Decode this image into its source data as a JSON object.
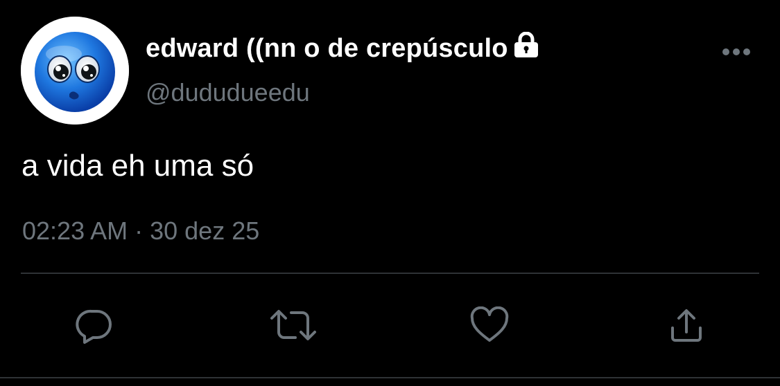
{
  "tweet": {
    "display_name": "edward ((nn o de crepúsculo",
    "handle": "@dududueedu",
    "text": "a vida eh uma só",
    "time": "02:23 AM",
    "separator": "·",
    "date": "30 dez 25"
  },
  "icons": {
    "lock": "lock-icon",
    "more": "more-horizontal-icon",
    "reply": "reply-bubble-icon",
    "retweet": "retweet-icon",
    "like": "heart-icon",
    "share": "share-upload-icon"
  },
  "colors": {
    "background": "#000000",
    "text": "#ffffff",
    "secondary": "#6e767d",
    "divider": "#2f3336",
    "avatar_blue": "#1f6fd6"
  }
}
